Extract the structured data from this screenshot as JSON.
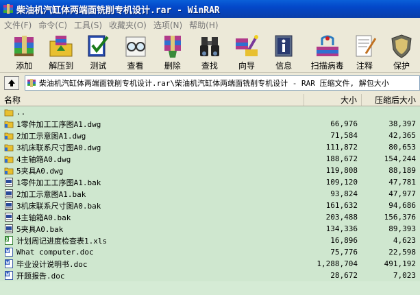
{
  "window": {
    "title": "柴油机汽缸体两端面铣削专机设计.rar - WinRAR"
  },
  "menu": [
    {
      "label": "文件(F)",
      "name": "menu-file"
    },
    {
      "label": "命令(C)",
      "name": "menu-commands"
    },
    {
      "label": "工具(S)",
      "name": "menu-tools"
    },
    {
      "label": "收藏夹(O)",
      "name": "menu-favorites"
    },
    {
      "label": "选项(N)",
      "name": "menu-options"
    },
    {
      "label": "帮助(H)",
      "name": "menu-help"
    }
  ],
  "toolbar": {
    "add": "添加",
    "extract": "解压到",
    "test": "测试",
    "view": "查看",
    "delete": "删除",
    "find": "查找",
    "wizard": "向导",
    "info": "信息",
    "scan": "扫描病毒",
    "comment": "注释",
    "protect": "保护"
  },
  "address": {
    "path": "柴油机汽缸体两端面铣削专机设计.rar\\柴油机汽缸体两端面铣削专机设计 - RAR 压缩文件, 解包大小"
  },
  "columns": {
    "name": "名称",
    "size": "大小",
    "packed": "压缩后大小"
  },
  "files": [
    {
      "name": "..",
      "size": "",
      "packed": "",
      "icon": "folder-up-icon"
    },
    {
      "name": "1零件加工工序图A1.dwg",
      "size": "66,976",
      "packed": "38,397",
      "icon": "dwg-file-icon"
    },
    {
      "name": "2加工示意图A1.dwg",
      "size": "71,584",
      "packed": "42,365",
      "icon": "dwg-file-icon"
    },
    {
      "name": "3机床联系尺寸图A0.dwg",
      "size": "111,872",
      "packed": "80,653",
      "icon": "dwg-file-icon"
    },
    {
      "name": "4主轴箱A0.dwg",
      "size": "188,672",
      "packed": "154,244",
      "icon": "dwg-file-icon"
    },
    {
      "name": "5夹具A0.dwg",
      "size": "119,808",
      "packed": "88,189",
      "icon": "dwg-file-icon"
    },
    {
      "name": "1零件加工工序图A1.bak",
      "size": "109,120",
      "packed": "47,781",
      "icon": "bak-file-icon"
    },
    {
      "name": "2加工示意图A1.bak",
      "size": "93,824",
      "packed": "47,977",
      "icon": "bak-file-icon"
    },
    {
      "name": "3机床联系尺寸图A0.bak",
      "size": "161,632",
      "packed": "94,686",
      "icon": "bak-file-icon"
    },
    {
      "name": "4主轴箱A0.bak",
      "size": "203,488",
      "packed": "156,376",
      "icon": "bak-file-icon"
    },
    {
      "name": "5夹具A0.bak",
      "size": "134,336",
      "packed": "89,393",
      "icon": "bak-file-icon"
    },
    {
      "name": "计划周记进度检查表1.xls",
      "size": "16,896",
      "packed": "4,623",
      "icon": "excel-file-icon"
    },
    {
      "name": "What computer.doc",
      "size": "75,776",
      "packed": "22,598",
      "icon": "word-file-icon"
    },
    {
      "name": "毕业设计说明书.doc",
      "size": "1,288,704",
      "packed": "491,192",
      "icon": "word-file-icon"
    },
    {
      "name": "开题报告.doc",
      "size": "28,672",
      "packed": "7,023",
      "icon": "word-file-icon"
    }
  ]
}
